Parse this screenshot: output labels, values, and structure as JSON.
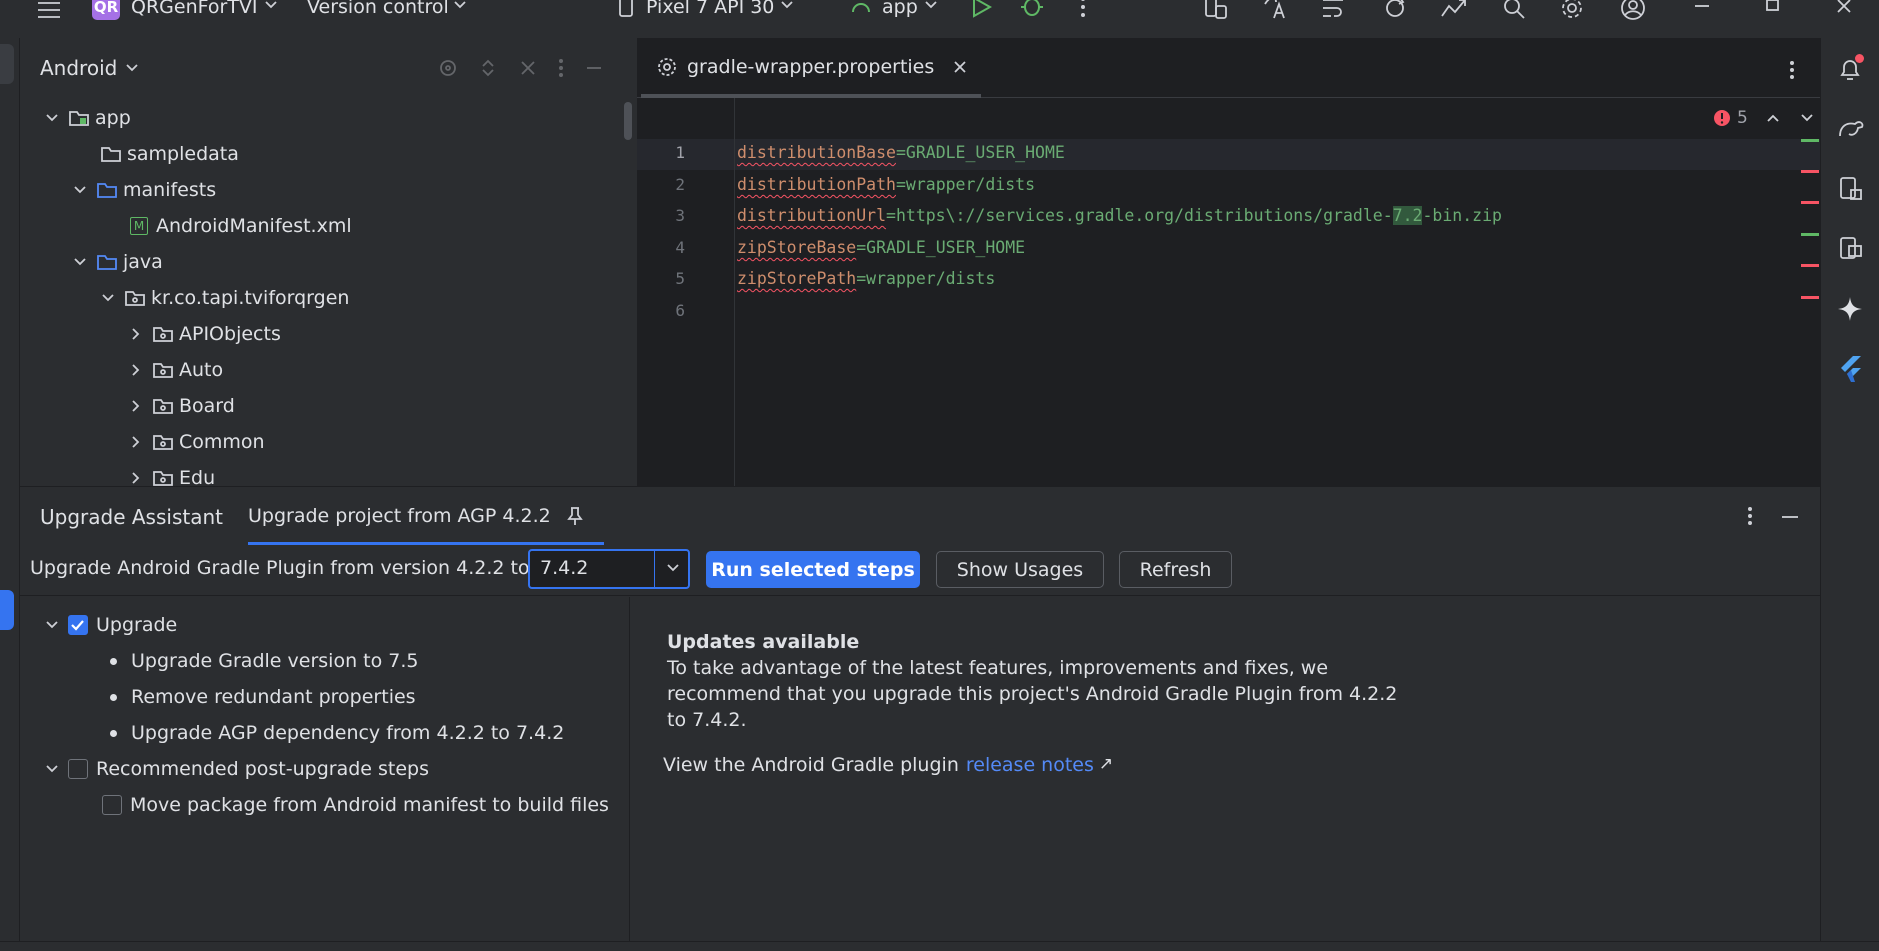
{
  "titlebar": {
    "project_badge": "QR",
    "project_name": "QRGenForTVI",
    "vcs": "Version control",
    "device": "Pixel 7 API 30",
    "run_config": "app"
  },
  "project_panel": {
    "view_label": "Android",
    "tree": [
      {
        "label": "app"
      },
      {
        "label": "sampledata"
      },
      {
        "label": "manifests"
      },
      {
        "label": "AndroidManifest.xml"
      },
      {
        "label": "java"
      },
      {
        "label": "kr.co.tapi.tviforqrgen"
      },
      {
        "label": "APIObjects"
      },
      {
        "label": "Auto"
      },
      {
        "label": "Board"
      },
      {
        "label": "Common"
      },
      {
        "label": "Edu"
      }
    ]
  },
  "editor": {
    "tab_label": "gradle-wrapper.properties",
    "problems_count": "5",
    "lines": [
      {
        "num": "1",
        "key": "distributionBase",
        "value": "=GRADLE_USER_HOME"
      },
      {
        "num": "2",
        "key": "distributionPath",
        "value": "=wrapper/dists"
      },
      {
        "num": "3",
        "key": "distributionUrl",
        "value_pre": "=https\\://services.gradle.org/distributions/gradle-",
        "value_hl": "7.2",
        "value_post": "-bin.zip"
      },
      {
        "num": "4",
        "key": "zipStoreBase",
        "value": "=GRADLE_USER_HOME"
      },
      {
        "num": "5",
        "key": "zipStorePath",
        "value": "=wrapper/dists"
      },
      {
        "num": "6"
      }
    ]
  },
  "upgrade": {
    "tool_title": "Upgrade Assistant",
    "tab_label": "Upgrade project from AGP 4.2.2",
    "from_label": "Upgrade Android Gradle Plugin from version 4.2.2 to",
    "version_value": "7.4.2",
    "run_button": "Run selected steps",
    "usages_button": "Show Usages",
    "refresh_button": "Refresh",
    "steps": {
      "upgrade_label": "Upgrade",
      "upgrade_checked": true,
      "upgrade_items": [
        "Upgrade Gradle version to 7.5",
        "Remove redundant properties",
        "Upgrade AGP dependency from 4.2.2 to 7.4.2"
      ],
      "post_label": "Recommended post-upgrade steps",
      "post_checked": false,
      "post_item": "Move package from Android manifest to build files"
    },
    "details": {
      "heading": "Updates available",
      "body_line1": "To take advantage of the latest features, improvements and fixes, we",
      "body_line2": "recommend that you upgrade this project's Android Gradle Plugin from 4.2.2",
      "body_line3": "to 7.4.2.",
      "link_prefix": "View the Android Gradle plugin",
      "link_text": "release notes",
      "link_arrow": "↗"
    }
  },
  "colors": {
    "accent": "#3574f0",
    "error": "#f75464",
    "success": "#5fb865",
    "badge": "#a571e6"
  }
}
